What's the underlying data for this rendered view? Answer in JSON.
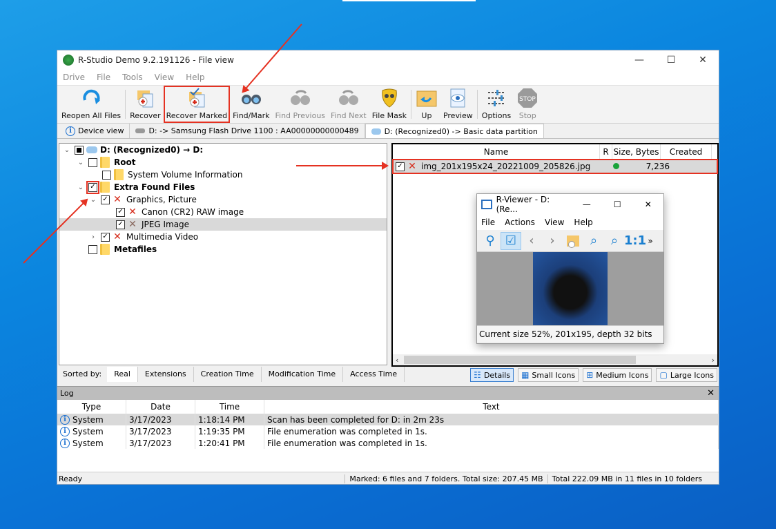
{
  "app": {
    "title": "R-Studio Demo 9.2.191126 - File view",
    "window_controls": {
      "minimize": "—",
      "maximize": "☐",
      "close": "✕"
    }
  },
  "menu": [
    "Drive",
    "File",
    "Tools",
    "View",
    "Help"
  ],
  "toolbar": [
    {
      "id": "reopen-all-files",
      "label": "Reopen All Files",
      "icon": "refresh-icon",
      "enabled": true
    },
    {
      "id": "recover",
      "label": "Recover",
      "icon": "recover-icon",
      "enabled": true
    },
    {
      "id": "recover-marked",
      "label": "Recover Marked",
      "icon": "recover-marked-icon",
      "enabled": true,
      "highlighted": true
    },
    {
      "id": "find-mark",
      "label": "Find/Mark",
      "icon": "binoculars-icon",
      "enabled": true
    },
    {
      "id": "find-previous",
      "label": "Find Previous",
      "icon": "find-previous-icon",
      "enabled": false
    },
    {
      "id": "find-next",
      "label": "Find Next",
      "icon": "find-next-icon",
      "enabled": false
    },
    {
      "id": "file-mask",
      "label": "File Mask",
      "icon": "mask-icon",
      "enabled": true
    },
    {
      "id": "up",
      "label": "Up",
      "icon": "folder-up-icon",
      "enabled": true
    },
    {
      "id": "preview",
      "label": "Preview",
      "icon": "eye-icon",
      "enabled": true
    },
    {
      "id": "options",
      "label": "Options",
      "icon": "sliders-icon",
      "enabled": true
    },
    {
      "id": "stop",
      "label": "Stop",
      "icon": "stop-icon",
      "enabled": false,
      "icon_text": "STOP"
    }
  ],
  "tabs": [
    {
      "label": "Device view",
      "active": false
    },
    {
      "label": "D: -> Samsung Flash Drive 1100 : AA00000000000489",
      "active": false
    },
    {
      "label": "D: (Recognized0) -> Basic data partition",
      "active": true
    }
  ],
  "tree": [
    {
      "label": "D: (Recognized0) → D:",
      "level": 0,
      "expanded": true,
      "check": "indeterminate",
      "icon": "drive-icon",
      "bold": true
    },
    {
      "label": "Root",
      "level": 1,
      "expanded": true,
      "check": "unchecked",
      "icon": "folder-icon",
      "bold": true
    },
    {
      "label": "System Volume Information",
      "level": 2,
      "check": "unchecked",
      "icon": "folder-icon",
      "bold": false
    },
    {
      "label": "Extra Found Files",
      "level": 1,
      "expanded": true,
      "check": "checked",
      "icon": "folder-icon",
      "bold": true,
      "highlighted": true
    },
    {
      "label": "Graphics, Picture",
      "level": 2,
      "expanded": true,
      "check": "checked",
      "icon": "deleted-icon",
      "bold": false
    },
    {
      "label": "Canon (CR2) RAW image",
      "level": 3,
      "check": "checked",
      "icon": "deleted-icon",
      "bold": false
    },
    {
      "label": "JPEG Image",
      "level": 3,
      "check": "checked",
      "icon": "deleted-icon",
      "bold": false,
      "selected": true
    },
    {
      "label": "Multimedia Video",
      "level": 2,
      "expanded": false,
      "check": "checked",
      "icon": "deleted-icon",
      "bold": false
    },
    {
      "label": "Metafiles",
      "level": 1,
      "check": "unchecked",
      "icon": "folder-icon",
      "bold": true
    }
  ],
  "files": {
    "columns": [
      "Name",
      "R",
      "Size, Bytes",
      "Created"
    ],
    "rows": [
      {
        "name": "img_201x195x24_20221009_205826.jpg",
        "checked": true,
        "status_color": "#1aa33a",
        "size": "7,236",
        "created": ""
      }
    ]
  },
  "viewer": {
    "title": "R-Viewer - D: (Re...",
    "menu": [
      "File",
      "Actions",
      "View",
      "Help"
    ],
    "tools": [
      "location-icon",
      "check-icon",
      "prev-icon",
      "next-icon",
      "recover-icon",
      "zoom-in-icon",
      "zoom-out-icon",
      "actual-size-icon",
      "more-icon"
    ],
    "actual_size_label": "1:1",
    "more_label": "»",
    "status": "Current size 52%, 201x195, depth 32 bits"
  },
  "sort": {
    "label": "Sorted by:",
    "tabs": [
      {
        "label": "Real",
        "active": true
      },
      {
        "label": "Extensions",
        "active": false
      },
      {
        "label": "Creation Time",
        "active": false
      },
      {
        "label": "Modification Time",
        "active": false
      },
      {
        "label": "Access Time",
        "active": false
      }
    ]
  },
  "view_modes": [
    {
      "label": "Details",
      "glyph": "☷",
      "active": true
    },
    {
      "label": "Small Icons",
      "glyph": "▦",
      "active": false
    },
    {
      "label": "Medium Icons",
      "glyph": "⊞",
      "active": false
    },
    {
      "label": "Large Icons",
      "glyph": "▢",
      "active": false
    }
  ],
  "log": {
    "title": "Log",
    "close": "✕",
    "columns": [
      "Type",
      "Date",
      "Time",
      "Text"
    ],
    "rows": [
      {
        "type": "System",
        "date": "3/17/2023",
        "time": "1:18:14 PM",
        "text": "Scan has been completed for D: in 2m 23s"
      },
      {
        "type": "System",
        "date": "3/17/2023",
        "time": "1:19:35 PM",
        "text": "File enumeration was completed in 1s."
      },
      {
        "type": "System",
        "date": "3/17/2023",
        "time": "1:20:41 PM",
        "text": "File enumeration was completed in 1s."
      }
    ]
  },
  "status": {
    "state": "Ready",
    "marked": "Marked: 6 files and 7 folders. Total size: 207.45 MB",
    "total": "Total 222.09 MB in 11 files in 10 folders"
  },
  "colors": {
    "annotation": "#e53222",
    "accent": "#1a6fd0"
  }
}
